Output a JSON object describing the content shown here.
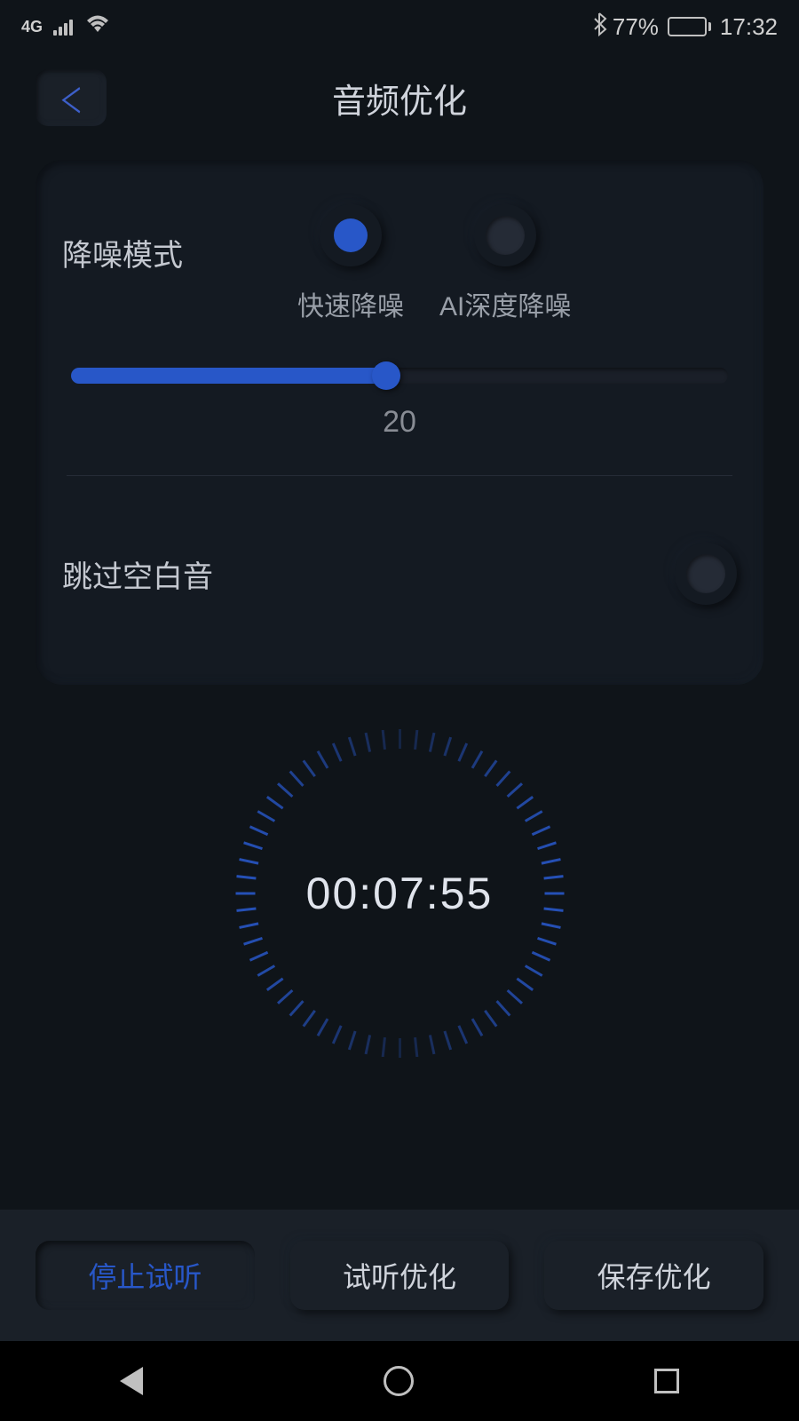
{
  "status": {
    "network": "4G",
    "bluetooth": "✱",
    "battery_percent": "77%",
    "time": "17:32"
  },
  "header": {
    "title": "音频优化"
  },
  "noise": {
    "label": "降噪模式",
    "option_fast": "快速降噪",
    "option_ai": "AI深度降噪",
    "slider_value": "20"
  },
  "skip": {
    "label": "跳过空白音"
  },
  "timer": {
    "time": "00:07:55"
  },
  "buttons": {
    "stop": "停止试听",
    "preview": "试听优化",
    "save": "保存优化"
  }
}
